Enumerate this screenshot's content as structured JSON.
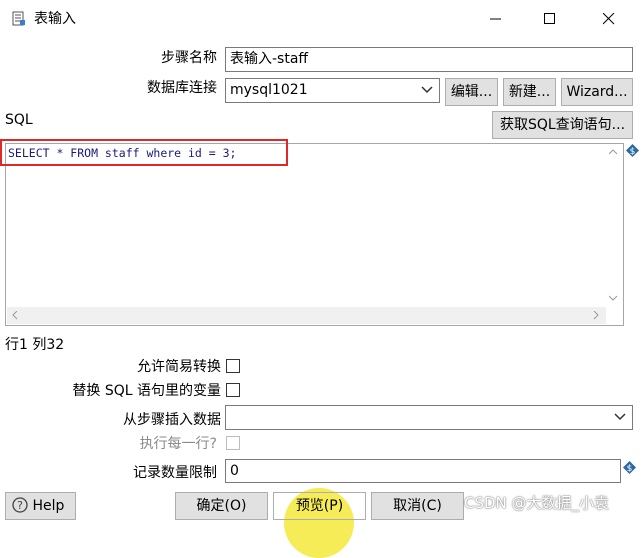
{
  "window": {
    "title": "表输入",
    "icon": "table-input-icon",
    "controls": [
      "minimize-icon",
      "maximize-icon",
      "close-icon"
    ]
  },
  "form": {
    "step_name_label": "步骤名称",
    "step_name_value": "表输入-staff",
    "db_conn_label": "数据库连接",
    "db_conn_value": "mysql1021",
    "edit_label": "编辑...",
    "new_label": "新建...",
    "wizard_label": "Wizard...",
    "sql_label": "SQL",
    "get_sql_label": "获取SQL查询语句...",
    "sql_text": "SELECT * FROM staff where id = 3;",
    "cursor_pos": "行1 列32",
    "lazy_conv_label": "允许简易转换",
    "replace_vars_label": "替换 SQL 语句里的变量",
    "insert_from_step_label": "从步骤插入数据",
    "insert_from_step_value": "",
    "exec_each_row_label": "执行每一行?",
    "limit_label": "记录数量限制",
    "limit_value": "0"
  },
  "buttons": {
    "help": "Help",
    "ok": "确定(O)",
    "preview": "预览(P)",
    "cancel": "取消(C)"
  },
  "watermark": "CSDN @大数据_小袁",
  "colors": {
    "highlight_border": "#e02828",
    "sql_text": "#1a1a80",
    "variable_icon": "#2a6aa0",
    "cursor_spot": "#f5e93a"
  }
}
